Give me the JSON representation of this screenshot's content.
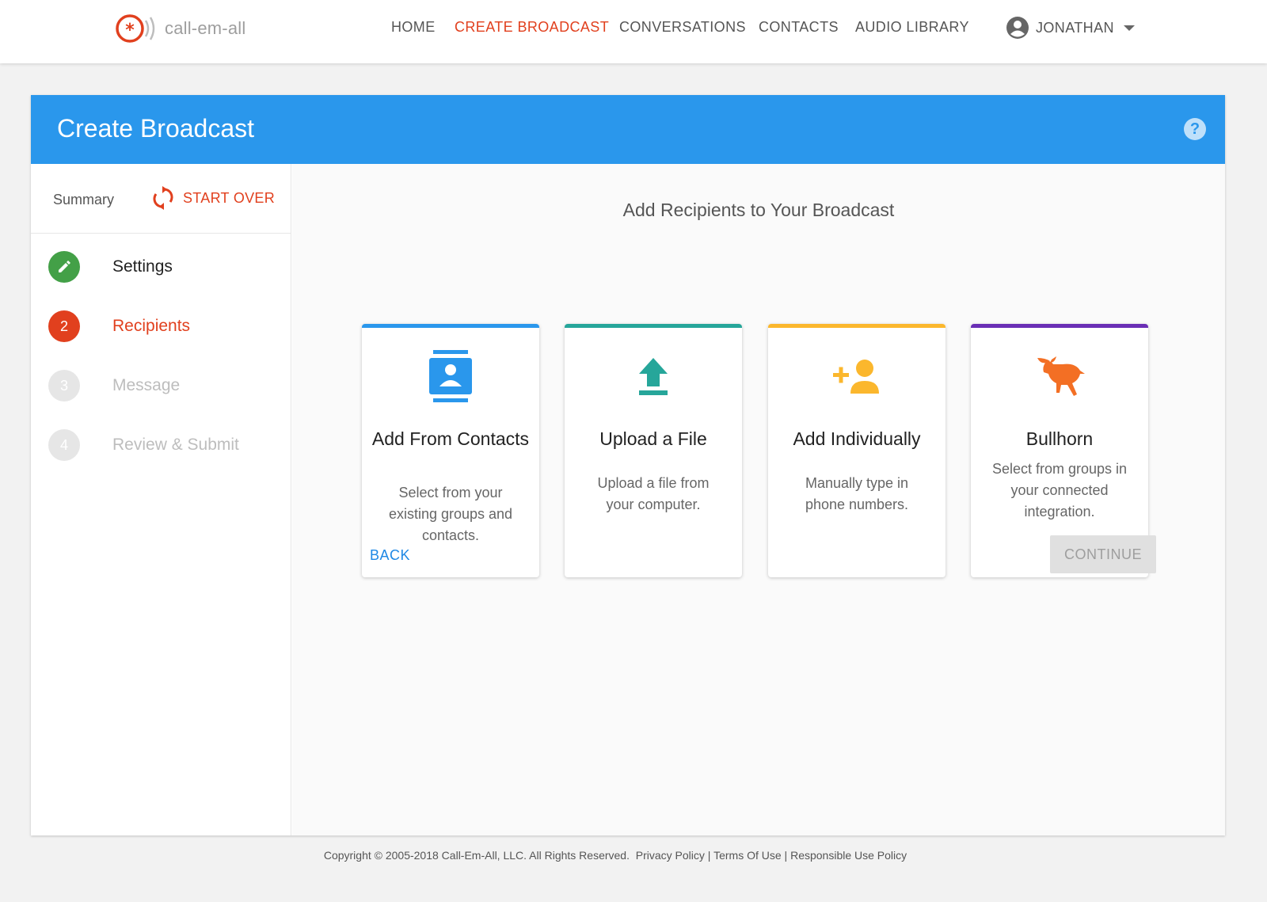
{
  "brand": {
    "name": "call-em-all",
    "logo_icon": "call-em-all-logo-icon",
    "accent": "#e1401e"
  },
  "nav": {
    "items": [
      {
        "label": "HOME",
        "active": false
      },
      {
        "label": "CREATE BROADCAST",
        "active": true
      },
      {
        "label": "CONVERSATIONS",
        "active": false
      },
      {
        "label": "CONTACTS",
        "active": false
      },
      {
        "label": "AUDIO LIBRARY",
        "active": false
      }
    ],
    "user": {
      "name": "JONATHAN",
      "icon": "account-circle-icon"
    }
  },
  "panel": {
    "title": "Create Broadcast",
    "header_color": "#2a97ec",
    "help_icon": "help-icon"
  },
  "sidebar": {
    "summary_label": "Summary",
    "start_over_label": "START OVER",
    "steps": [
      {
        "number": "",
        "label": "Settings",
        "state": "complete",
        "icon": "pencil-icon",
        "color": "#43a047"
      },
      {
        "number": "2",
        "label": "Recipients",
        "state": "active",
        "color": "#e1401e"
      },
      {
        "number": "3",
        "label": "Message",
        "state": "pending",
        "color": "#e0e0e0"
      },
      {
        "number": "4",
        "label": "Review & Submit",
        "state": "pending",
        "color": "#e0e0e0"
      }
    ]
  },
  "main": {
    "title": "Add Recipients to Your Broadcast",
    "cards": [
      {
        "title": "Add From Contacts",
        "description": "Select from your existing groups and contacts.",
        "icon": "contacts-icon",
        "color": "#2a97ec"
      },
      {
        "title": "Upload a File",
        "description": "Upload a file from your computer.",
        "icon": "upload-icon",
        "color": "#26a69a"
      },
      {
        "title": "Add Individually",
        "description": "Manually type in phone numbers.",
        "icon": "person-add-icon",
        "color": "#fbb72d"
      },
      {
        "title": "Bullhorn",
        "description": "Select from groups in your connected integration.",
        "icon": "bull-icon",
        "color": "#6a2fb5"
      }
    ],
    "back_label": "BACK",
    "continue_label": "CONTINUE"
  },
  "footer": {
    "copyright": "Copyright © 2005-2018 Call-Em-All, LLC. All Rights Reserved.",
    "links": [
      "Privacy Policy",
      "Terms Of Use",
      "Responsible Use Policy"
    ]
  }
}
